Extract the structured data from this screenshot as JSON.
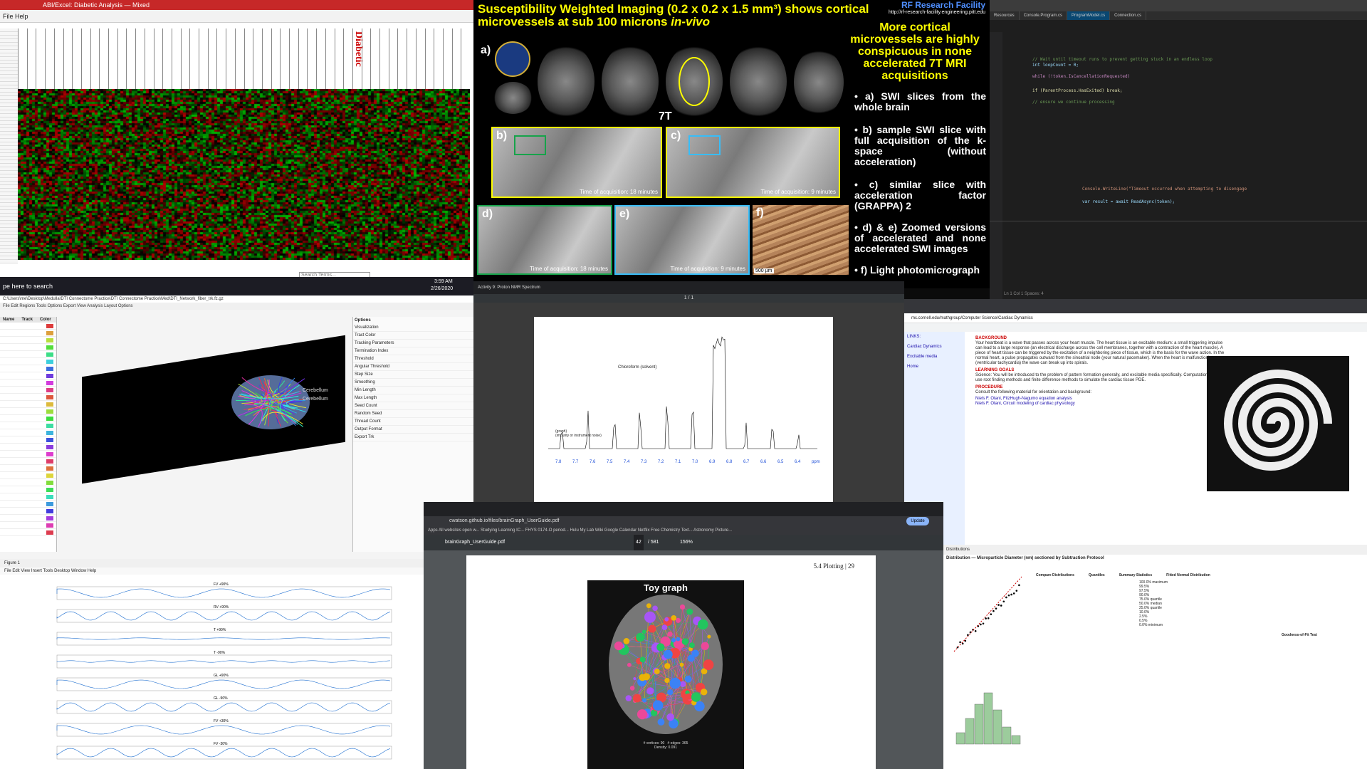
{
  "heatmap_window": {
    "title": "ABI/Excel: Diabetic Analysis — Mixed",
    "menu": "File  Help",
    "highlight_label": "Diabetic",
    "search_text": "Search Terms...",
    "taskbar_search": "pe here to search",
    "taskbar_time": "3:59 AM",
    "taskbar_date": "2/26/2020"
  },
  "swi_slide": {
    "title_prefix": "Susceptibility Weighted Imaging (0.2 x 0.2 x 1.5 mm³) shows cortical microvessels at sub 100 microns",
    "title_italic": "in-vivo",
    "facility": "RF Research Facility",
    "url": "http://rf-research-facility.engineering.pitt.edu",
    "subheading": "More cortical microvessels are highly conspicuous in none accelerated 7T MRI acquisitions",
    "field_label": "7T",
    "bullets": [
      "a) SWI slices from the whole brain",
      "b) sample SWI slice with full acquisition of the k-space (without acceleration)",
      "c) similar slice with acceleration factor (GRAPPA) 2",
      "d) & e) Zoomed versions of accelerated and none accelerated SWI images",
      "f) Light photomicrograph"
    ],
    "panel_labels": [
      "a)",
      "b)",
      "c)",
      "d)",
      "e)",
      "f)"
    ],
    "cap_b": "Time of acquisition: 18 minutes",
    "cap_c": "Time of acquisition: 9 minutes",
    "cap_d": "Time of acquisition: 18 minutes",
    "cap_e": "Time of acquisition: 9 minutes",
    "cap_f": "500 µm"
  },
  "code_editor": {
    "tabs": [
      "Resources",
      "Console.Program.cs",
      "ProgramModel.cs",
      "Connection.cs"
    ],
    "lines": [
      "// Wait until timeout runs to prevent getting stuck in an endless loop",
      "int loopCount = 0;",
      "while (!token.IsCancellationRequested)",
      "if (ParentProcess.HasExited) break;",
      "// ensure we continue processing",
      "Console.WriteLine(\"Timeout occurred when attempting to disengage",
      "var result = await ReadAsync(token);"
    ],
    "status": "Ln 1  Col 1  Spaces: 4"
  },
  "tracto": {
    "path": "C:\\Users\\me\\Desktop\\Medulla\\DTI Connectome Practice\\DTI Connectome Practice\\Med\\DTI_Network_fiber_trk.fz.gz",
    "menu": [
      "File",
      "Edit",
      "Regions",
      "Tools",
      "Options",
      "Export",
      "View",
      "Analysis",
      "Layout",
      "Options"
    ],
    "list_header": [
      "Name",
      "Track",
      "Color"
    ],
    "label_top": "Cerebellum",
    "label_bottom": "Cerebellum",
    "right_title": "Options",
    "right_rows": [
      "Visualization",
      "Tract Color",
      "Tracking Parameters",
      "Termination Index",
      "Threshold",
      "Angular Threshold",
      "Step Size",
      "Smoothing",
      "Min Length",
      "Max Length",
      "Seed Count",
      "Random Seed",
      "Thread Count",
      "Output Format",
      "Export Trk"
    ]
  },
  "nmr": {
    "tab_title": "Activity 9: Proton NMR Spectrum",
    "page": "1 / 1",
    "compound_label": "Chloroform (solvent)",
    "impurity": "(graph)\n(impurity or instrument noise)",
    "ppm_ticks": [
      "7.8",
      "7.7",
      "7.6",
      "7.5",
      "7.4",
      "7.3",
      "7.2",
      "7.1",
      "7.0",
      "6.9",
      "6.8",
      "6.7",
      "6.6",
      "6.5",
      "6.4"
    ],
    "ppm_unit": "ppm"
  },
  "browser_bg": {
    "url": "mc.cornell.edu/mathgroup/Computer Science/Cardiac Dynamics",
    "heading1": "BACKGROUND",
    "para1": "Your heartbeat is a wave that passes across your heart muscle. The heart tissue is an excitable medium: a small triggering impulse can lead to a large response (an electrical discharge across the cell membranes, together with a contraction of the heart muscle). A piece of heart tissue can be triggered by the excitation of a neighboring piece of tissue, which is the basis for the wave action. In the normal heart, a pulse propagates outward from the sinoatrial node (your natural pacemaker). When the heart is malfunctioning (ventricular tachycardia) the wave can break up into spirals.",
    "heading2": "LEARNING GOALS",
    "para2": "Science: You will be introduced to the problem of pattern formation generally, and excitable media specifically. Computation: You will use root finding methods and finite difference methods to simulate the cardiac tissue PDE.",
    "heading3": "PROCEDURE",
    "para3": "Consult the following material for orientation and background:",
    "links": [
      "Niels F. Otani, FitzHugh-Nagumo equation analysis",
      "Niels F. Otani, Circuit modeling of cardiac physiology"
    ],
    "side_links": [
      "LINKS:",
      "Cardiac Dynamics",
      "Excitable media",
      "Home"
    ]
  },
  "waves": {
    "window_title": "Figure 1",
    "menu": "File  Edit  View  Insert  Tools  Desktop  Window  Help",
    "channels": [
      "FV +90%",
      "RV +90%",
      "T +90%",
      "T -90%",
      "GL +90%",
      "GL -90%",
      "FV +30%",
      "FV -30%"
    ]
  },
  "braingraph": {
    "url": "cwatson.github.io/files/brainGraph_UserGuide.pdf",
    "file": "brainGraph_UserGuide.pdf",
    "page": "42",
    "pages_total": "/ 581",
    "zoom": "156%",
    "section": "5.4 Plotting",
    "page_number": "29",
    "plot_title": "Toy graph",
    "vertices": "# vertices: 90",
    "edges": "# edges: 365",
    "density": "Density: 0.091",
    "update_btn": "Update",
    "bookmarks": [
      "Apps",
      "All websites open w...",
      "Studying Learning IC...",
      "FHYS 0174-O period...",
      "Hulu",
      "My Lab Wiki",
      "Google Calendar",
      "Netflix",
      "Free Chemistry Text...",
      "Astronomy Picture..."
    ]
  },
  "jmp": {
    "title": "Distributions",
    "header": "Distribution — Microparticle Diameter (nm) sectioned by Subtraction Protocol",
    "panels": [
      "Compare Distributions",
      "Quantiles",
      "Summary Statistics",
      "Fitted Normal Distribution"
    ],
    "rows": [
      "100.0% maximum",
      "99.5%",
      "97.5%",
      "90.0%",
      "75.0% quartile",
      "50.0% median",
      "25.0% quartile",
      "10.0%",
      "2.5%",
      "0.5%",
      "0.0% minimum"
    ],
    "goodness": "Goodness-of-Fit Test"
  }
}
